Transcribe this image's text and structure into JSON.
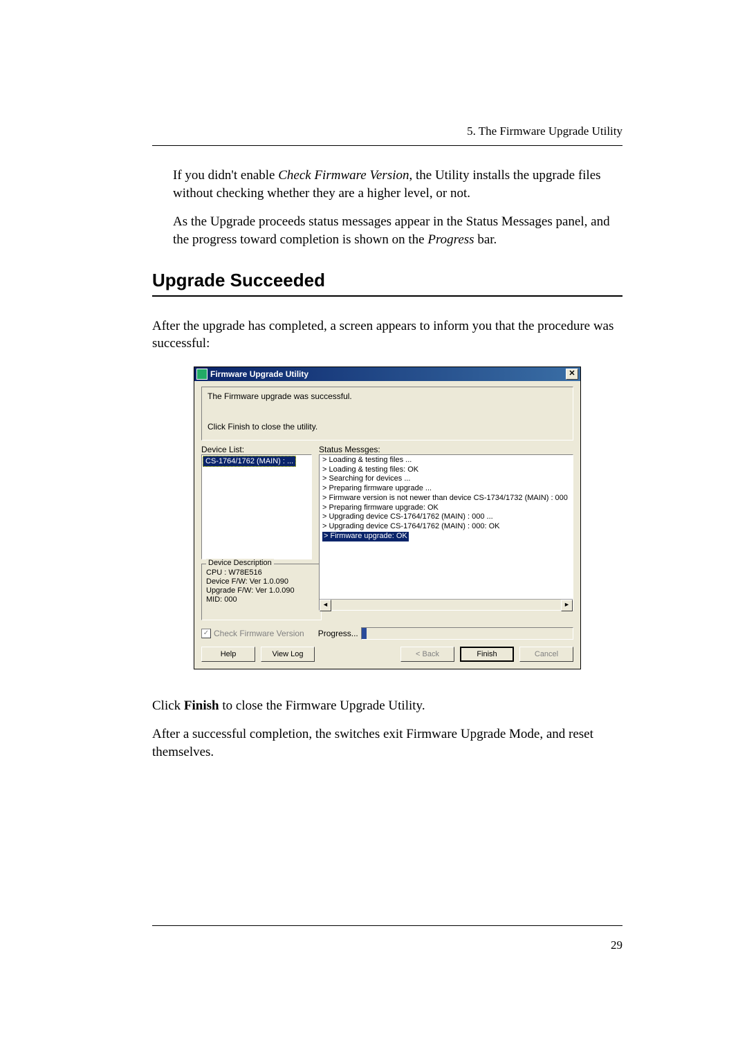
{
  "doc": {
    "chapter_header": "5. The Firmware Upgrade Utility",
    "para1_a": "If you didn't enable ",
    "para1_i": "Check Firmware Version",
    "para1_b": ", the Utility installs the upgrade files without checking whether they are a higher level, or not.",
    "para2_a": "As the Upgrade proceeds status messages appear in the Status Messages panel, and the progress toward completion is shown on the ",
    "para2_i": "Progress",
    "para2_b": " bar.",
    "section_title": "Upgrade Succeeded",
    "para3": "After the upgrade has completed, a screen appears to inform you that the procedure was successful:",
    "para4_a": "Click ",
    "para4_bold": "Finish",
    "para4_b": " to close the Firmware Upgrade Utility.",
    "para5": "After a successful completion, the switches exit Firmware Upgrade Mode, and reset themselves.",
    "page_number": "29"
  },
  "dialog": {
    "title": "Firmware Upgrade Utility",
    "close_glyph": "✕",
    "info_line1": "The Firmware upgrade was successful.",
    "info_line2": "Click Finish to close the utility.",
    "device_list_label": "Device List:",
    "status_label": "Status Messges:",
    "device_selected": "CS-1764/1762 (MAIN) : ...",
    "status_lines": [
      "> Loading & testing files ...",
      "> Loading & testing files: OK",
      "> Searching for devices ...",
      "> Preparing firmware upgrade ...",
      "> Firmware version is not newer than device CS-1734/1732 (MAIN) : 000",
      "> Preparing firmware upgrade: OK",
      "> Upgrading device CS-1764/1762 (MAIN) : 000 ...",
      "> Upgrading device CS-1764/1762 (MAIN) : 000: OK"
    ],
    "status_highlight": "> Firmware upgrade: OK",
    "group_title": "Device Description",
    "group_lines": [
      "CPU : W78E516",
      "Device F/W: Ver 1.0.090",
      "Upgrade F/W: Ver 1.0.090",
      "MID: 000"
    ],
    "check_label": "Check Firmware Version",
    "check_mark": "✓",
    "progress_label": "Progress...",
    "buttons": {
      "help": "Help",
      "viewlog": "View Log",
      "back": "< Back",
      "finish": "Finish",
      "cancel": "Cancel"
    },
    "scroll_left": "◄",
    "scroll_right": "►"
  }
}
